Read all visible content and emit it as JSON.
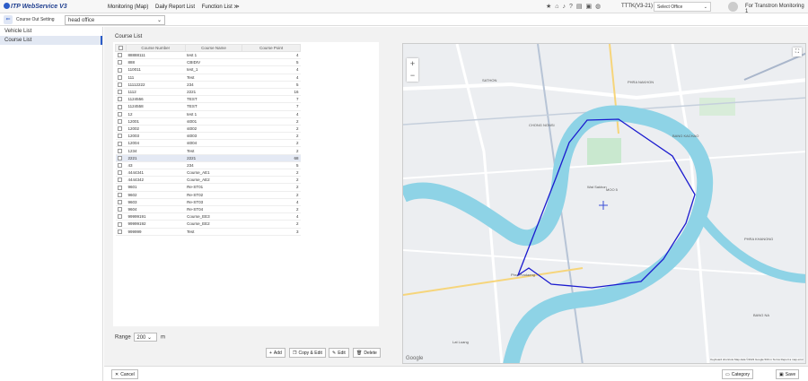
{
  "app": {
    "logo_text": "ITP WebService V3",
    "menu": [
      "Monitoring (Map)",
      "Daily Report List",
      "Function List ≫"
    ],
    "office_code": "TTTK(V3-21)",
    "office_select_value": "Select Office",
    "username": "For Transtron Monitoring 1"
  },
  "subbar": {
    "label": "Course Out Setting",
    "office_value": "head office"
  },
  "sidebar": {
    "items": [
      "Vehicle List",
      "Course List"
    ]
  },
  "main": {
    "title": "Course List",
    "columns": [
      "Course Number",
      "Course Name",
      "Course Point"
    ],
    "rows": [
      [
        "88888111",
        "test 1",
        "4"
      ],
      [
        "888",
        "CBIDIV",
        "5"
      ],
      [
        "110011",
        "test_1",
        "4"
      ],
      [
        "111",
        "Test",
        "4"
      ],
      [
        "11112222",
        "234",
        "5"
      ],
      [
        "1112",
        "2221",
        "16"
      ],
      [
        "1124556",
        "TEST",
        "7"
      ],
      [
        "1124558",
        "TEST",
        "7"
      ],
      [
        "12",
        "test 1",
        "4"
      ],
      [
        "12001",
        "st001",
        "2"
      ],
      [
        "12002",
        "st002",
        "2"
      ],
      [
        "12003",
        "st003",
        "2"
      ],
      [
        "12004",
        "st004",
        "2"
      ],
      [
        "1234",
        "Test",
        "2"
      ],
      [
        "2221",
        "2221",
        "68"
      ],
      [
        "43",
        "234",
        "5"
      ],
      [
        "4444341",
        "Course_AE1",
        "2"
      ],
      [
        "4444342",
        "Course_AE2",
        "2"
      ],
      [
        "9601",
        "Re-ST01",
        "2"
      ],
      [
        "9602",
        "Re-ST02",
        "2"
      ],
      [
        "9603",
        "Re-ST03",
        "4"
      ],
      [
        "9604",
        "Re-ST04",
        "2"
      ],
      [
        "99999191",
        "Course_EE3",
        "4"
      ],
      [
        "99999192",
        "Course_EE2",
        "2"
      ],
      [
        "999999",
        "Test",
        "3"
      ]
    ],
    "selected_row": 14,
    "range_label": "Range",
    "range_value": "200",
    "range_unit": "m",
    "buttons": {
      "add": "Add",
      "copy_edit": "Copy & Edit",
      "edit": "Edit",
      "delete": "Delete"
    }
  },
  "map": {
    "labels": [
      "PHRA NAKHON",
      "SATHON",
      "PHRA KHANONG",
      "BANG NA",
      "Lat Luang",
      "Phra Pradaeng",
      "CHONG NONSI",
      "BANG KACHAO",
      "Wat Sakhon",
      "MOO 5"
    ],
    "zoom_in": "+",
    "zoom_out": "−",
    "google_text": "Google",
    "attribution": "Keyboard shortcuts  Map data ©2023 Google  500 m  Terms  Report a map error"
  },
  "footer": {
    "cancel": "Cancel",
    "category": "Category",
    "save": "Save"
  },
  "colors": {
    "accent": "#2b5cc8",
    "river": "#8ed3e6",
    "route": "#1b1bcf"
  }
}
